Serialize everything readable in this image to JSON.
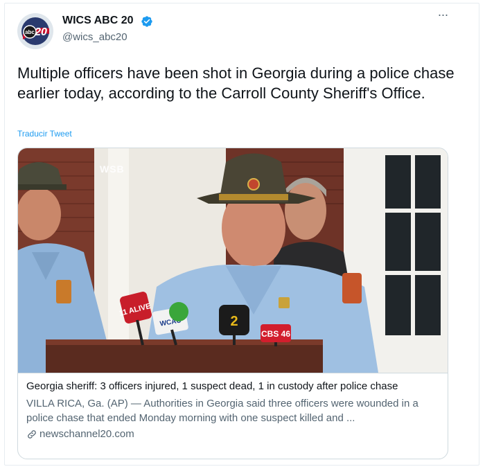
{
  "account": {
    "name": "WICS ABC 20",
    "handle": "@wics_abc20",
    "avatar_text": "abc 20"
  },
  "tweet": {
    "text": "Multiple officers have been shot in Georgia during a police chase earlier today, according to the Carroll County Sheriff's Office.",
    "translate_label": "Traducir Tweet",
    "more_label": "···"
  },
  "card": {
    "watermark": "WSB",
    "mic_labels": [
      "11 ALIVE",
      "WCAU",
      "2",
      "CBS 46"
    ],
    "title": "Georgia sheriff: 3 officers injured, 1 suspect dead, 1 in custody after police chase",
    "description": "VILLA RICA, Ga. (AP) — Authorities in Georgia said three officers were wounded in a police chase that ended Monday morning with one suspect killed and ...",
    "domain": "newschannel20.com"
  },
  "icons": {
    "verified": "verified-badge-icon",
    "more": "more-options-icon",
    "link": "link-icon"
  },
  "colors": {
    "accent": "#1d9bf0",
    "text": "#0f1419",
    "secondary": "#536471",
    "border": "#cfd9de"
  }
}
